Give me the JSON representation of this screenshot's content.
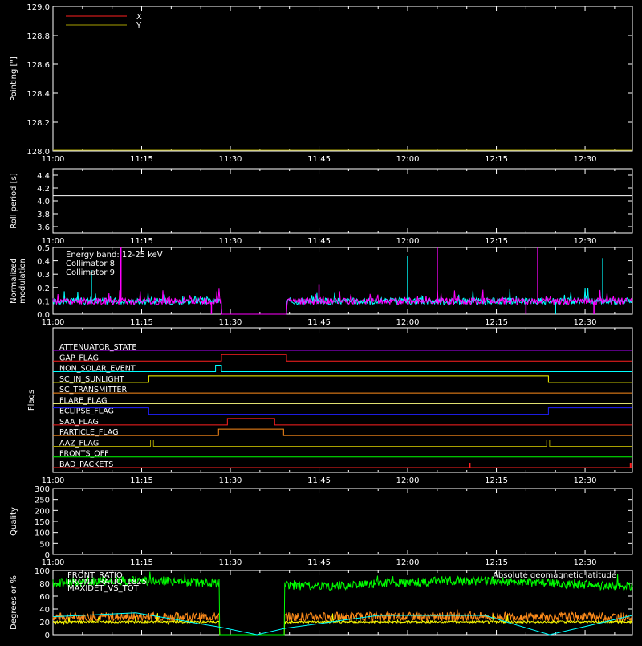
{
  "colors": {
    "background": "#000000",
    "frame": "#ffffff",
    "red": "#ff2020",
    "olive": "#a8a000",
    "cyan": "#00ffff",
    "magenta": "#ff00ff",
    "green": "#00ff00",
    "orange": "#ff8c1a",
    "yellow": "#ffff00",
    "blue": "#2020ff",
    "lightyellow": "#ffff80",
    "purple": "#b000ff"
  },
  "time_axis": {
    "start": "11:00",
    "end": "12:38",
    "tick_labels": [
      "11:00",
      "11:15",
      "11:30",
      "11:45",
      "12:00",
      "12:15",
      "12:30"
    ],
    "tick_minutes": [
      0,
      15,
      30,
      45,
      60,
      75,
      90
    ]
  },
  "chart_data": [
    {
      "type": "line",
      "id": "pointing",
      "ylabel": "Pointing [\"]",
      "ylim": [
        128.0,
        129.0
      ],
      "yticks": [
        "128.0",
        "128.2",
        "128.4",
        "128.6",
        "128.8",
        "129.0"
      ],
      "ytick_values": [
        128.0,
        128.2,
        128.4,
        128.6,
        128.8,
        129.0
      ],
      "series": [
        {
          "name": "X",
          "color": "red",
          "values": []
        },
        {
          "name": "Y",
          "color": "olive",
          "values": [
            [
              0,
              128.0
            ],
            [
              98,
              128.0
            ]
          ]
        }
      ]
    },
    {
      "type": "line",
      "id": "roll",
      "ylabel": "Roll period [s]",
      "ylim": [
        3.5,
        4.5
      ],
      "yticks": [
        "3.6",
        "3.8",
        "4.0",
        "4.2",
        "4.4"
      ],
      "ytick_values": [
        3.6,
        3.8,
        4.0,
        4.2,
        4.4
      ],
      "series": [
        {
          "color": "frame",
          "values": [
            [
              0,
              4.08
            ],
            [
              98,
              4.08
            ]
          ]
        }
      ]
    },
    {
      "type": "line",
      "id": "modulation",
      "ylabel": [
        "Normalized",
        "modulation"
      ],
      "ylim": [
        0,
        0.5
      ],
      "yticks": [
        "0.0",
        "0.1",
        "0.2",
        "0.3",
        "0.4",
        "0.5"
      ],
      "ytick_values": [
        0,
        0.1,
        0.2,
        0.3,
        0.4,
        0.5
      ],
      "legend": {
        "title": "Energy band: 12-25 keV",
        "placement": "top-left"
      },
      "baseline": 0.09,
      "gaps": [
        [
          28.5,
          39.5
        ]
      ],
      "series": [
        {
          "name": "Collimator 8",
          "color": "cyan",
          "spikes": [
            [
              6.5,
              0.33
            ],
            [
              60,
              0.44
            ],
            [
              93,
              0.42
            ]
          ]
        },
        {
          "name": "Collimator 9",
          "color": "magenta",
          "spikes": [
            [
              11.5,
              0.5
            ],
            [
              65,
              0.5
            ],
            [
              82,
              0.5
            ],
            [
              45,
              0.22
            ]
          ]
        }
      ]
    },
    {
      "type": "line",
      "id": "flags",
      "ylabel": "Flags",
      "flags": [
        {
          "label": "ATTENUATOR_STATE",
          "color": "purple",
          "steps": []
        },
        {
          "label": "GAP_FLAG",
          "color": "red",
          "steps": [
            [
              28.5,
              39.5
            ]
          ]
        },
        {
          "label": "NON_SOLAR_EVENT",
          "color": "cyan",
          "steps": [
            [
              27.5,
              28.5
            ]
          ]
        },
        {
          "label": "SC_IN_SUNLIGHT",
          "color": "yellow",
          "steps": [
            [
              16.2,
              83.8
            ]
          ]
        },
        {
          "label": "SC_TRANSMITTER",
          "color": "orange",
          "steps": []
        },
        {
          "label": "FLARE_FLAG",
          "color": "lightyellow",
          "steps": []
        },
        {
          "label": "ECLIPSE_FLAG",
          "color": "blue",
          "steps": [
            [
              0,
              16.2
            ],
            [
              83.8,
              98
            ]
          ]
        },
        {
          "label": "SAA_FLAG",
          "color": "red",
          "steps": [
            [
              29.5,
              37.5
            ]
          ]
        },
        {
          "label": "PARTICLE_FLAG",
          "color": "orange",
          "steps": [
            [
              28,
              39
            ]
          ]
        },
        {
          "label": "AAZ_FLAG",
          "color": "olive",
          "steps": [
            [
              16.5,
              17
            ],
            [
              83.5,
              84
            ]
          ]
        },
        {
          "label": "FRONTS_OFF",
          "color": "green",
          "steps": []
        },
        {
          "label": "BAD_PACKETS",
          "color": "red",
          "spikes": [
            70.5,
            97.7
          ]
        }
      ]
    },
    {
      "type": "line",
      "id": "quality",
      "ylabel": "Quality",
      "ylim": [
        0,
        300
      ],
      "yticks": [
        "0",
        "50",
        "100",
        "150",
        "200",
        "250",
        "300"
      ],
      "ytick_values": [
        0,
        50,
        100,
        150,
        200,
        250,
        300
      ],
      "series": []
    },
    {
      "type": "line",
      "id": "ratios",
      "ylabel": "Degrees or %",
      "ylim": [
        0,
        100
      ],
      "yticks": [
        "0",
        "20",
        "40",
        "60",
        "80",
        "100"
      ],
      "ytick_values": [
        0,
        20,
        40,
        60,
        80,
        100
      ],
      "gaps": [
        [
          28.2,
          39.2
        ]
      ],
      "legend_right": "Absolute geomagnetic latitude",
      "series": [
        {
          "name": "FRONT_RATIO",
          "color": "yellow",
          "level": 20
        },
        {
          "name": "FRONT_RATIO_1825",
          "color": "green",
          "level": 80
        },
        {
          "name": "MAXIDET_VS_TOT",
          "color": "orange",
          "level": 28
        },
        {
          "name": "Absolute geomagnetic latitude",
          "color": "cyan",
          "values": [
            [
              0,
              28
            ],
            [
              14,
              34
            ],
            [
              28.2,
              12
            ],
            [
              34.5,
              0
            ],
            [
              39.2,
              10
            ],
            [
              55,
              30
            ],
            [
              73,
              30
            ],
            [
              84,
              0
            ],
            [
              98,
              30
            ]
          ]
        }
      ]
    }
  ]
}
